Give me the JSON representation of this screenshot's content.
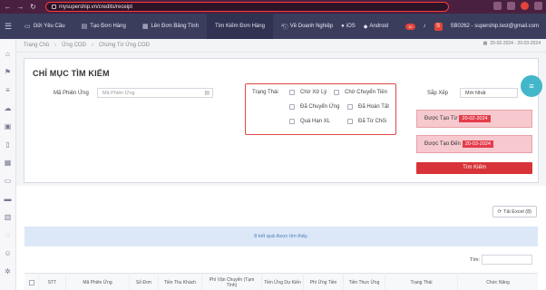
{
  "browser": {
    "url": "mysupership.vn/credits/receipt"
  },
  "topnav": {
    "items": [
      {
        "icon": "chat-icon",
        "label": "Gửi Yêu Cầu"
      },
      {
        "icon": "document-icon",
        "label": "Tạo Đơn Hàng"
      },
      {
        "icon": "table-icon",
        "label": "Lên Đơn Bảng Tính"
      },
      {
        "icon": "",
        "label": "Tìm Kiếm Đơn Hàng"
      }
    ],
    "right": {
      "business": "Về Doanh Nghiệp",
      "ios": "iOS",
      "android": "Android",
      "badge": "10",
      "user": "SB0262 - supership.test@gmail.com"
    }
  },
  "breadcrumb": [
    "Trang Chủ",
    "Ứng COD",
    "Chứng Từ Ứng COD"
  ],
  "daterange": "20-02-2024 - 20-03-2024",
  "search": {
    "title": "CHỈ MỤC TÌM KIẾM",
    "code_label": "Mã Phiên Ứng",
    "code_placeholder": "Mã Phiên Ứng",
    "status_label": "Trạng Thái",
    "statuses": [
      "Chờ Xử Lý",
      "Chờ Chuyển Tiền",
      "Đã Chuyển Ứng",
      "Đã Hoàn Tất",
      "Quá Hạn XL",
      "Đã Từ Chối"
    ],
    "sort_label": "Sắp Xếp",
    "sort_value": "Mới Nhất",
    "from_label": "Được Tạo Từ",
    "from_value": "20-02-2024",
    "to_label": "Được Tạo Đến",
    "to_value": "20-03-2024",
    "button": "Tìm Kiếm"
  },
  "excel_button": "Tải Excel (8)",
  "notice": "8 kết quả được tìm thấy.",
  "filter_label": "Tìm:",
  "table": {
    "columns": [
      "STT",
      "Mã Phiên Ứng",
      "Số Đơn",
      "Tiền Thu Khách",
      "Phí Vận Chuyển (Tạm Tính)",
      "Tiền Ứng Dự Kiến",
      "Phí Ứng Tiền",
      "Tiền Thực Ứng",
      "Trạng Thái",
      "Chức Năng"
    ]
  },
  "colors": {
    "topnav": "#3a3d5c",
    "accent_red": "#d83338",
    "fab": "#43b7c9",
    "notice_bg": "#dce8f8"
  }
}
